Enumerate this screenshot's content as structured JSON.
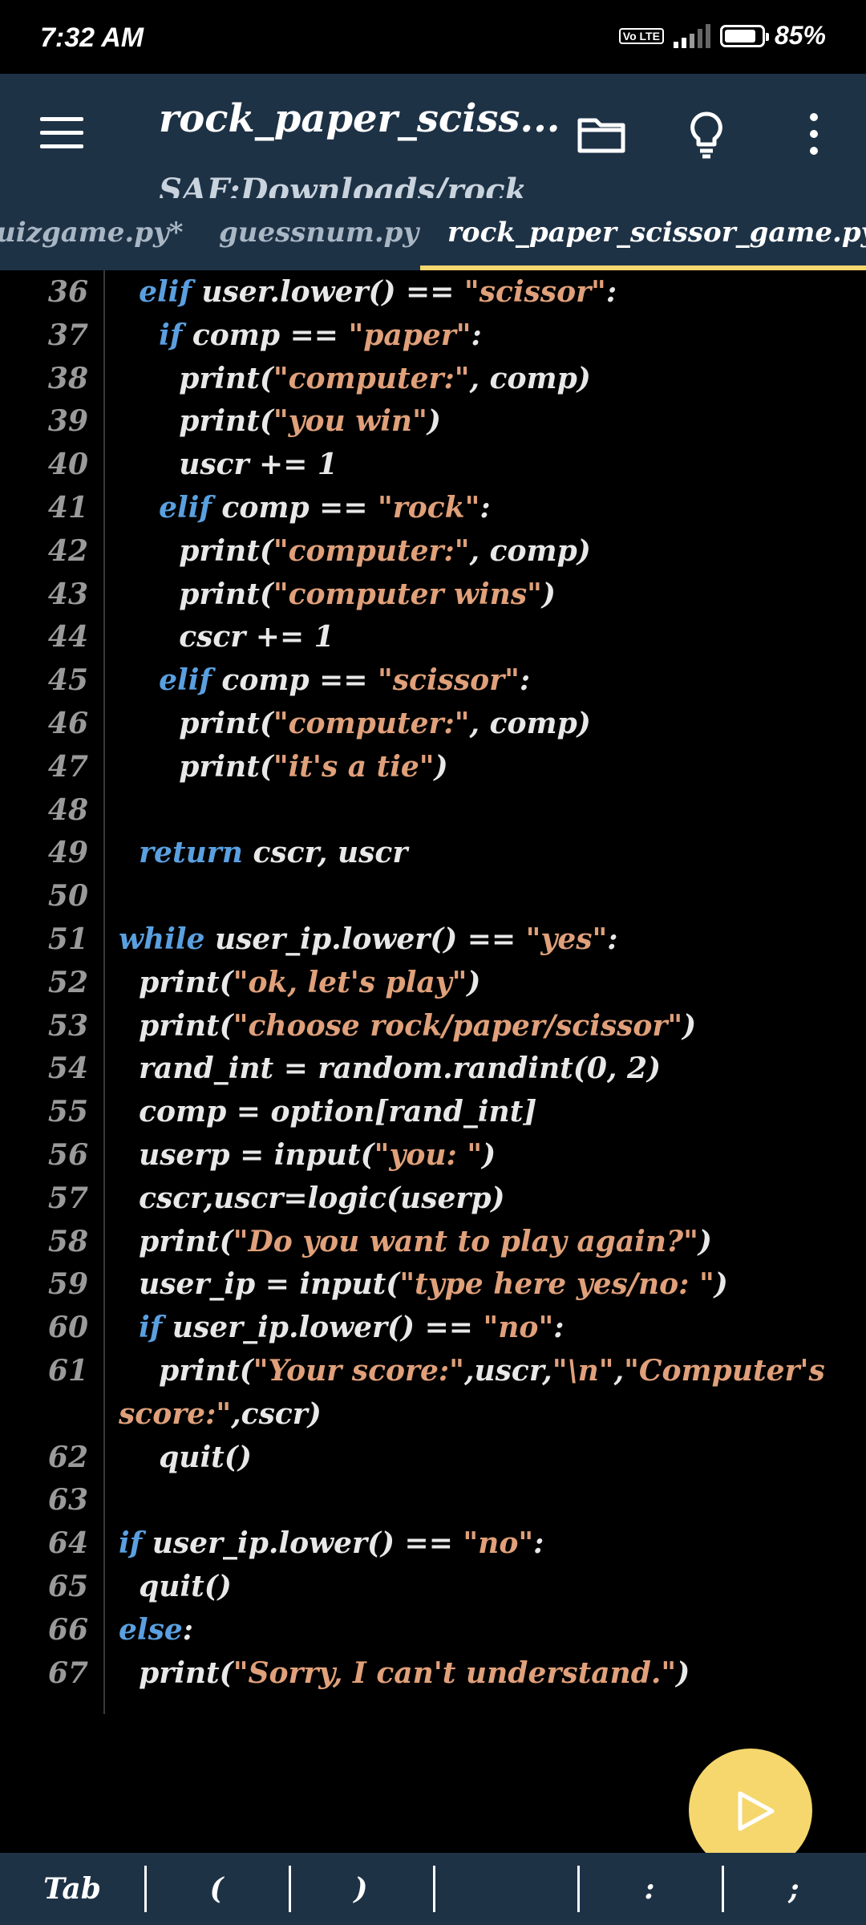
{
  "status_bar": {
    "time": "7:32 AM",
    "network_label": "Vo LTE",
    "battery_percent": "85%",
    "battery_level": 0.85
  },
  "app_bar": {
    "title": "rock_paper_sciss...",
    "subtitle": "SAF:Downloads/rock",
    "icons": [
      "menu-icon",
      "folder-icon",
      "lightbulb-icon",
      "more-vert-icon"
    ]
  },
  "tabs": [
    {
      "label": "uizgame.py*",
      "active": false
    },
    {
      "label": "guessnum.py",
      "active": false
    },
    {
      "label": "rock_paper_scissor_game.py",
      "active": true
    }
  ],
  "code": {
    "lines": [
      {
        "n": "36",
        "parts": [
          [
            "",
            "  "
          ],
          [
            "k",
            "elif"
          ],
          [
            "",
            " user.lower() == "
          ],
          [
            "s",
            "\"scissor\""
          ],
          [
            "",
            ":"
          ]
        ]
      },
      {
        "n": "37",
        "parts": [
          [
            "",
            "    "
          ],
          [
            "k",
            "if"
          ],
          [
            "",
            " comp == "
          ],
          [
            "s",
            "\"paper\""
          ],
          [
            "",
            ":"
          ]
        ]
      },
      {
        "n": "38",
        "parts": [
          [
            "",
            "      print("
          ],
          [
            "s",
            "\"computer:\""
          ],
          [
            "",
            ", comp)"
          ]
        ]
      },
      {
        "n": "39",
        "parts": [
          [
            "",
            "      print("
          ],
          [
            "s",
            "\"you win\""
          ],
          [
            "",
            ")"
          ]
        ]
      },
      {
        "n": "40",
        "parts": [
          [
            "",
            "      uscr += 1"
          ]
        ]
      },
      {
        "n": "41",
        "parts": [
          [
            "",
            "    "
          ],
          [
            "k",
            "elif"
          ],
          [
            "",
            " comp == "
          ],
          [
            "s",
            "\"rock\""
          ],
          [
            "",
            ":"
          ]
        ]
      },
      {
        "n": "42",
        "parts": [
          [
            "",
            "      print("
          ],
          [
            "s",
            "\"computer:\""
          ],
          [
            "",
            ", comp)"
          ]
        ]
      },
      {
        "n": "43",
        "parts": [
          [
            "",
            "      print("
          ],
          [
            "s",
            "\"computer wins\""
          ],
          [
            "",
            ")"
          ]
        ]
      },
      {
        "n": "44",
        "parts": [
          [
            "",
            "      cscr += 1"
          ]
        ]
      },
      {
        "n": "45",
        "parts": [
          [
            "",
            "    "
          ],
          [
            "k",
            "elif"
          ],
          [
            "",
            " comp == "
          ],
          [
            "s",
            "\"scissor\""
          ],
          [
            "",
            ":"
          ]
        ]
      },
      {
        "n": "46",
        "parts": [
          [
            "",
            "      print("
          ],
          [
            "s",
            "\"computer:\""
          ],
          [
            "",
            ", comp)"
          ]
        ]
      },
      {
        "n": "47",
        "parts": [
          [
            "",
            "      print("
          ],
          [
            "s",
            "\"it's a tie\""
          ],
          [
            "",
            ")"
          ]
        ]
      },
      {
        "n": "48",
        "parts": []
      },
      {
        "n": "49",
        "parts": [
          [
            "",
            "  "
          ],
          [
            "k",
            "return"
          ],
          [
            "",
            " cscr, uscr"
          ]
        ]
      },
      {
        "n": "50",
        "parts": []
      },
      {
        "n": "51",
        "parts": [
          [
            "k",
            "while"
          ],
          [
            "",
            " user_ip.lower() == "
          ],
          [
            "s",
            "\"yes\""
          ],
          [
            "",
            ":"
          ]
        ]
      },
      {
        "n": "52",
        "parts": [
          [
            "",
            "  print("
          ],
          [
            "s",
            "\"ok, let's play\""
          ],
          [
            "",
            ")"
          ]
        ]
      },
      {
        "n": "53",
        "parts": [
          [
            "",
            "  print("
          ],
          [
            "s",
            "\"choose rock/paper/scissor\""
          ],
          [
            "",
            ")"
          ]
        ]
      },
      {
        "n": "54",
        "parts": [
          [
            "",
            "  rand_int = random.randint(0, 2)"
          ]
        ]
      },
      {
        "n": "55",
        "parts": [
          [
            "",
            "  comp = option[rand_int]"
          ]
        ]
      },
      {
        "n": "56",
        "parts": [
          [
            "",
            "  userp = input("
          ],
          [
            "s",
            "\"you: \""
          ],
          [
            "",
            ")"
          ]
        ]
      },
      {
        "n": "57",
        "parts": [
          [
            "",
            "  cscr,uscr=logic(userp)"
          ]
        ]
      },
      {
        "n": "58",
        "parts": [
          [
            "",
            "  print("
          ],
          [
            "s",
            "\"Do you want to play again?\""
          ],
          [
            "",
            ")"
          ]
        ]
      },
      {
        "n": "59",
        "parts": [
          [
            "",
            "  user_ip = input("
          ],
          [
            "s",
            "\"type here yes/no: \""
          ],
          [
            "",
            ")"
          ]
        ]
      },
      {
        "n": "60",
        "parts": [
          [
            "",
            "  "
          ],
          [
            "k",
            "if"
          ],
          [
            "",
            " user_ip.lower() == "
          ],
          [
            "s",
            "\"no\""
          ],
          [
            "",
            ":"
          ]
        ]
      },
      {
        "n": "61",
        "parts": [
          [
            "",
            "    print("
          ],
          [
            "s",
            "\"Your score:\""
          ],
          [
            "",
            ",uscr,"
          ],
          [
            "s",
            "\"\\n\""
          ],
          [
            "",
            ","
          ],
          [
            "s",
            "\"Computer's"
          ]
        ]
      },
      {
        "n": "",
        "parts": [
          [
            "s",
            "score:\""
          ],
          [
            "",
            ",cscr)"
          ]
        ]
      },
      {
        "n": "62",
        "parts": [
          [
            "",
            "    quit()"
          ]
        ]
      },
      {
        "n": "63",
        "parts": []
      },
      {
        "n": "64",
        "parts": [
          [
            "k",
            "if"
          ],
          [
            "",
            " user_ip.lower() == "
          ],
          [
            "s",
            "\"no\""
          ],
          [
            "",
            ":"
          ]
        ]
      },
      {
        "n": "65",
        "parts": [
          [
            "",
            "  quit()"
          ]
        ]
      },
      {
        "n": "66",
        "parts": [
          [
            "k",
            "else"
          ],
          [
            "",
            ":"
          ]
        ]
      },
      {
        "n": "67",
        "parts": [
          [
            "",
            "  print("
          ],
          [
            "s",
            "\"Sorry, I can't understand.\""
          ],
          [
            "",
            ")"
          ]
        ]
      }
    ]
  },
  "fab": {
    "icon": "play-icon"
  },
  "extra_keys": [
    "Tab",
    "(",
    ")",
    "",
    ":",
    ";"
  ],
  "colors": {
    "app_bar": "#1e3246",
    "keyword": "#5aa0e0",
    "string": "#e0a07a",
    "text": "#e8e8e8",
    "accent": "#f5d76e"
  }
}
